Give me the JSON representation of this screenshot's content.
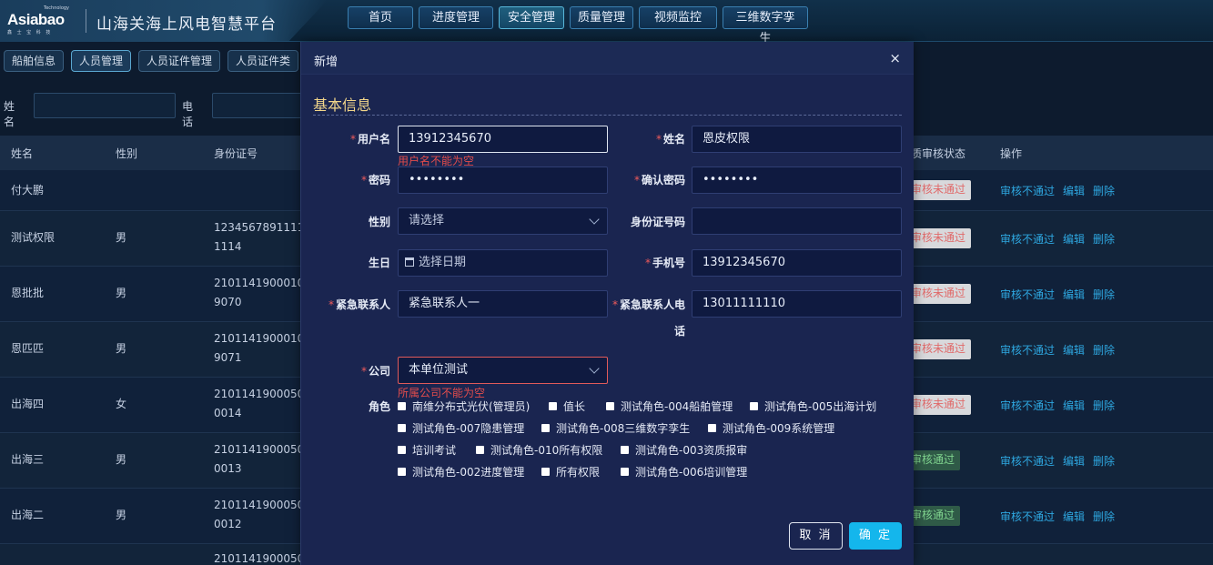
{
  "header": {
    "logo_main": "Asiabao",
    "logo_sup": "Technology",
    "logo_sub": "鑫 士 宝 科 技",
    "title": "山海关海上风电智慧平台",
    "nav": [
      "首页",
      "进度管理",
      "安全管理",
      "质量管理",
      "视频监控",
      "三维数字孪生"
    ],
    "active_nav": "安全管理"
  },
  "subtabs": [
    "船舶信息",
    "人员管理",
    "人员证件管理",
    "人员证件类"
  ],
  "filter": {
    "name_label": "姓名",
    "phone_label": "电话"
  },
  "table": {
    "columns": [
      "姓名",
      "性别",
      "身份证号",
      "质审核状态",
      "操作"
    ],
    "rows": [
      {
        "name": "付大鹏",
        "gender": "",
        "id1": "",
        "id2": "",
        "status": "审核未通过",
        "status_type": "fail"
      },
      {
        "name": "测试权限",
        "gender": "男",
        "id1": "12345678911111",
        "id2": "1114",
        "status": "审核未通过",
        "status_type": "fail"
      },
      {
        "name": "恩批批",
        "gender": "男",
        "id1": "21011419000101",
        "id2": "9070",
        "status": "审核未通过",
        "status_type": "fail"
      },
      {
        "name": "恩匹匹",
        "gender": "男",
        "id1": "21011419000101",
        "id2": "9071",
        "status": "审核未通过",
        "status_type": "fail"
      },
      {
        "name": "出海四",
        "gender": "女",
        "id1": "21011419000506",
        "id2": "0014",
        "status": "审核未通过",
        "status_type": "fail"
      },
      {
        "name": "出海三",
        "gender": "男",
        "id1": "21011419000506",
        "id2": "0013",
        "status": "审核通过",
        "status_type": "pass"
      },
      {
        "name": "出海二",
        "gender": "男",
        "id1": "21011419000506",
        "id2": "0012",
        "status": "审核通过",
        "status_type": "pass"
      },
      {
        "name": "",
        "gender": "",
        "id1": "21011419000506",
        "id2": "",
        "status": "",
        "status_type": ""
      }
    ],
    "ops": [
      "审核不通过",
      "编辑",
      "删除"
    ]
  },
  "dialog": {
    "title": "新增",
    "close": "×",
    "section": "基本信息",
    "fields": {
      "username_label": "用户名",
      "username_value": "13912345670",
      "username_error": "用户名不能为空",
      "name_label": "姓名",
      "name_value": "恩皮权限",
      "password_label": "密码",
      "password_value": "••••••••",
      "confirm_label": "确认密码",
      "confirm_value": "••••••••",
      "gender_label": "性别",
      "gender_placeholder": "请选择",
      "idcard_label": "身份证号码",
      "idcard_value": "",
      "birthday_label": "生日",
      "birthday_placeholder": "选择日期",
      "phone_label": "手机号",
      "phone_value": "13912345670",
      "emergency_label": "紧急联系人",
      "emergency_value": "紧急联系人一",
      "emergency_phone_label_1": "紧急联系人电",
      "emergency_phone_label_2": "话",
      "emergency_phone_value": "13011111110",
      "company_label": "公司",
      "company_value": "本单位测试",
      "company_error": "所属公司不能为空",
      "role_label": "角色"
    },
    "roles": [
      "南维分布式光伏(管理员)",
      "值长",
      "测试角色-004船舶管理",
      "测试角色-005出海计划",
      "测试角色-007隐患管理",
      "测试角色-008三维数字孪生",
      "测试角色-009系统管理",
      "培训考试",
      "测试角色-010所有权限",
      "测试角色-003资质报审",
      "测试角色-002进度管理",
      "所有权限",
      "测试角色-006培训管理"
    ],
    "cancel_label": "取 消",
    "ok_label": "确 定"
  }
}
